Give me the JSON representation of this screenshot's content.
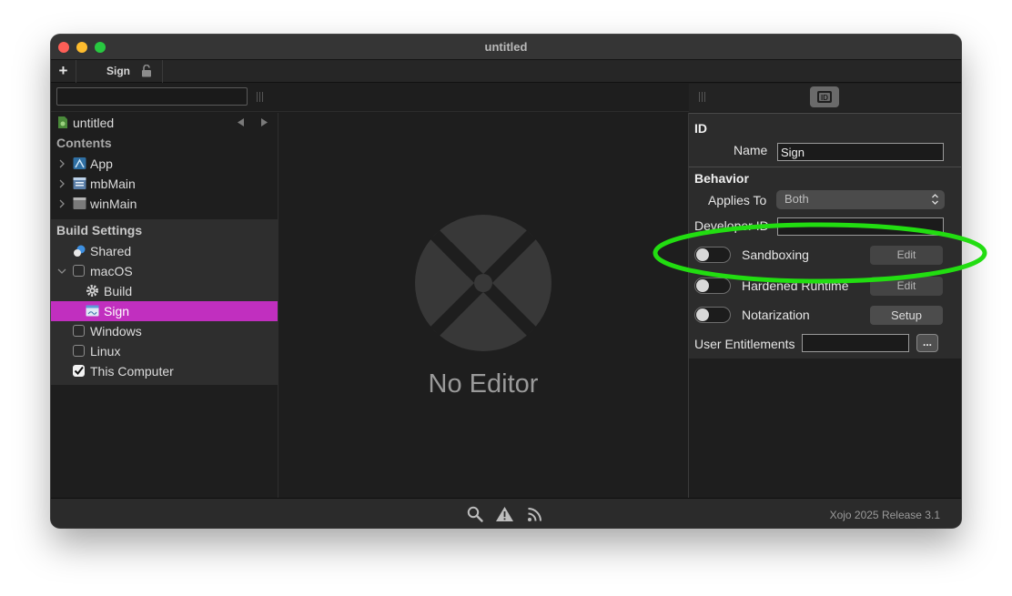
{
  "window": {
    "title": "untitled"
  },
  "tabbar": {
    "add_label": "+",
    "active_tab": "Sign"
  },
  "sidebar": {
    "project_name": "untitled",
    "contents_header": "Contents",
    "contents_items": [
      {
        "label": "App",
        "icon": "app-icon"
      },
      {
        "label": "mbMain",
        "icon": "menubar-icon"
      },
      {
        "label": "winMain",
        "icon": "window-icon"
      }
    ],
    "build_settings_header": "Build Settings",
    "build_items": {
      "shared": "Shared",
      "macos": "macOS",
      "build": "Build",
      "sign": "Sign",
      "windows": "Windows",
      "linux": "Linux",
      "this_computer": "This Computer"
    },
    "selection_color": "#c12fbf"
  },
  "center": {
    "placeholder": "No Editor"
  },
  "inspector": {
    "id_header": "ID",
    "name_label": "Name",
    "name_value": "Sign",
    "behavior_header": "Behavior",
    "applies_to_label": "Applies To",
    "applies_to_value": "Both",
    "developer_id_label": "Developer ID",
    "developer_id_value": "",
    "sandboxing_label": "Sandboxing",
    "sandboxing_on": false,
    "sandboxing_button": "Edit",
    "hardened_runtime_label": "Hardened Runtime",
    "hardened_runtime_on": false,
    "hardened_runtime_button": "Edit",
    "notarization_label": "Notarization",
    "notarization_on": false,
    "notarization_button": "Setup",
    "user_entitlements_label": "User Entitlements",
    "user_entitlements_value": "",
    "user_entitlements_button": "..."
  },
  "statusbar": {
    "version": "Xojo 2025 Release 3.1"
  },
  "annotation": {
    "color": "#22dd11"
  }
}
